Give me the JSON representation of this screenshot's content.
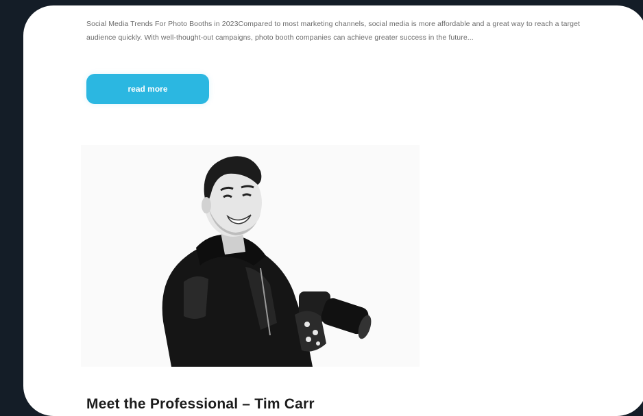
{
  "post_excerpt": {
    "text": "Social Media Trends For Photo Booths in 2023Compared to most marketing channels, social media is more affordable and a great way to reach a target audience quickly. With well-thought-out campaigns, photo booth companies can achieve greater success in the future..."
  },
  "read_more": {
    "label": "read more"
  },
  "next_post": {
    "title": "Meet the Professional – Tim Carr",
    "image_icon": "portrait-photo"
  },
  "colors": {
    "background": "#141d27",
    "card": "#ffffff",
    "accent": "#2bb7e1",
    "text_muted": "#6b6b6b",
    "title": "#1c1c1c"
  }
}
